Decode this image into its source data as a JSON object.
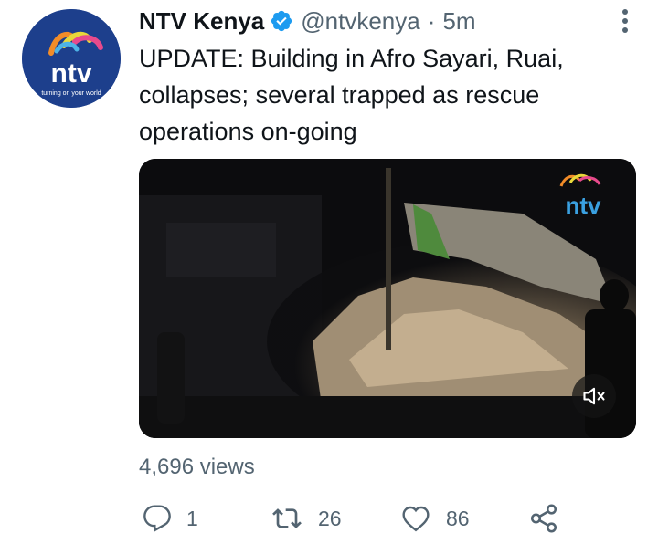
{
  "author": {
    "display_name": "NTV Kenya",
    "handle": "@ntvkenya",
    "separator": "·",
    "time": "5m",
    "avatar_logo_text": "ntv",
    "avatar_tagline": "turning on your world"
  },
  "tweet": {
    "text": "UPDATE: Building in Afro Sayari, Ruai, collapses; several trapped as rescue operations on-going"
  },
  "media": {
    "watermark": "ntv",
    "muted": true
  },
  "stats": {
    "views": "4,696 views"
  },
  "actions": {
    "replies": "1",
    "retweets": "26",
    "likes": "86"
  },
  "colors": {
    "verified": "#1d9bf0",
    "secondary_text": "#536471",
    "avatar_bg": "#1d3f8c"
  }
}
